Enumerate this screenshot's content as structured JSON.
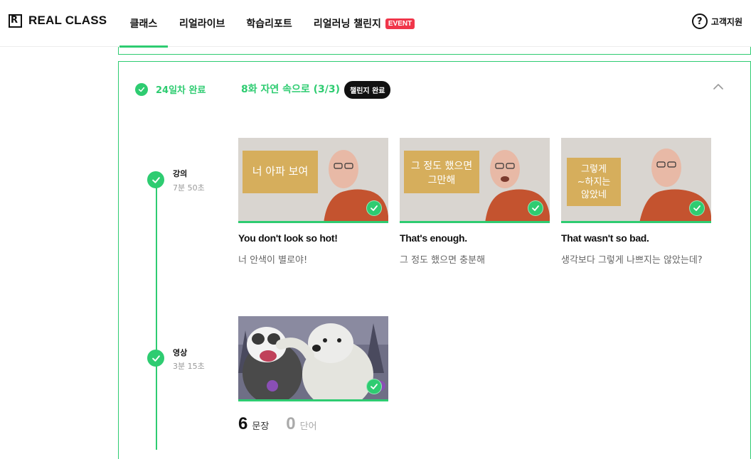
{
  "brand": {
    "name": "REAL CLASS",
    "mark": "R"
  },
  "nav": {
    "items": [
      {
        "label": "클래스",
        "active": true
      },
      {
        "label": "리얼라이브"
      },
      {
        "label": "학습리포트"
      },
      {
        "label": "리얼러닝 챌린지",
        "badge": "EVENT"
      }
    ]
  },
  "support": {
    "label": "고객지원",
    "icon": "?"
  },
  "day": {
    "status": "24일차 완료",
    "episode": "8화 자연 속으로 (3/3)",
    "pill": "챌린지 완료"
  },
  "sections": [
    {
      "title": "강의",
      "duration": "7분 50초"
    },
    {
      "title": "영상",
      "duration": "3분 15초"
    }
  ],
  "lessons": [
    {
      "board": [
        "너 아파 보여"
      ],
      "title": "You don't look so hot!",
      "subtitle": "너 안색이 별로야!"
    },
    {
      "board": [
        "그 정도 했으면",
        "그만해"
      ],
      "title": "That's enough.",
      "subtitle": "그 정도 했으면 충분해"
    },
    {
      "board": [
        "그렇게",
        "~하지는",
        "않았네"
      ],
      "title": "That wasn't so bad.",
      "subtitle": "생각보다 그렇게 나쁘지는 않았는데?"
    }
  ],
  "video_stats": {
    "sentences": {
      "value": "6",
      "label": "문장"
    },
    "words": {
      "value": "0",
      "label": "단어"
    }
  },
  "colors": {
    "accent": "#2ecc71",
    "event": "#f0364a",
    "board": "#d6ae5c",
    "shirt": "#c4532f"
  }
}
